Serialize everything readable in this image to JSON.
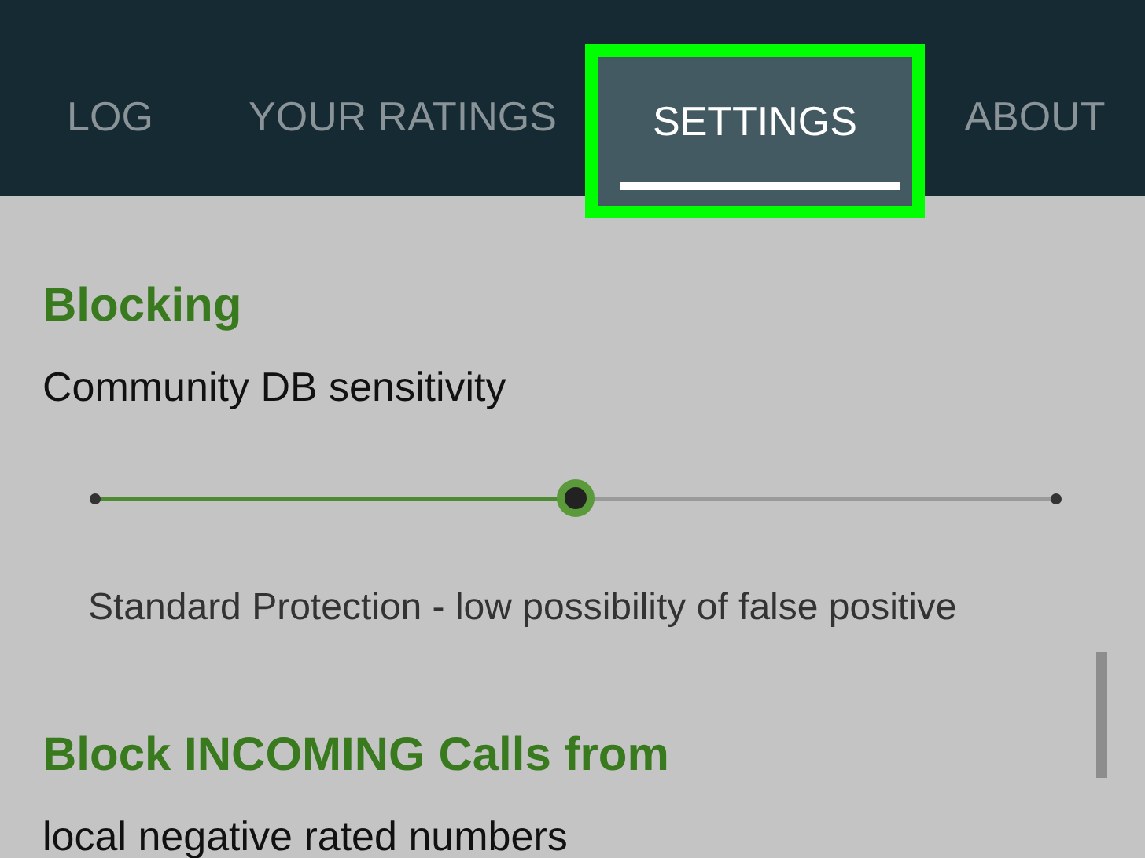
{
  "tabs": [
    {
      "label": "LOG",
      "selected": false
    },
    {
      "label": "YOUR RATINGS",
      "selected": false
    },
    {
      "label": "SETTINGS",
      "selected": true
    },
    {
      "label": "ABOUT",
      "selected": false
    }
  ],
  "sections": [
    {
      "title": "Blocking",
      "subtitle": "Community DB sensitivity",
      "slider": {
        "level": 0.5
      },
      "description": "Standard Protection - low possibility of false positive"
    },
    {
      "title": "Block INCOMING Calls from",
      "subtitle": "local negative rated numbers"
    }
  ]
}
